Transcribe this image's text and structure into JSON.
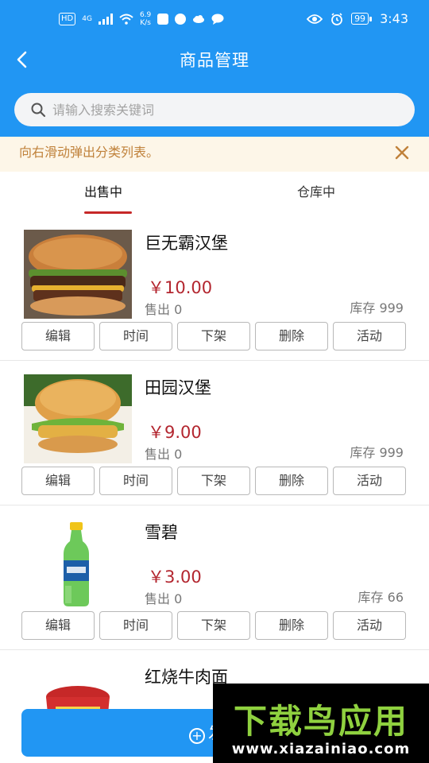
{
  "status_bar": {
    "network": "HD",
    "signal_type": "4G",
    "speed_value": "6.9",
    "speed_unit": "K/s",
    "battery": "99",
    "time": "3:43"
  },
  "header": {
    "title": "商品管理"
  },
  "search": {
    "placeholder": "请输入搜索关键词"
  },
  "notice": {
    "text": "向右滑动弹出分类列表。"
  },
  "tabs": [
    {
      "label": "出售中",
      "active": true
    },
    {
      "label": "仓库中",
      "active": false
    }
  ],
  "products": [
    {
      "name": "巨无霸汉堡",
      "price": "￥10.00",
      "sold": "售出 0",
      "stock": "库存 999",
      "image": "burger-icon"
    },
    {
      "name": "田园汉堡",
      "price": "￥9.00",
      "sold": "售出 0",
      "stock": "库存 999",
      "image": "chicken-burger-icon"
    },
    {
      "name": "雪碧",
      "price": "￥3.00",
      "sold": "售出 0",
      "stock": "库存 66",
      "image": "soda-bottle-icon"
    },
    {
      "name": "红烧牛肉面",
      "price": "",
      "sold": "",
      "stock": "",
      "image": "instant-noodle-icon"
    }
  ],
  "actions": [
    "编辑",
    "时间",
    "下架",
    "删除",
    "活动"
  ],
  "publish_button": {
    "label": "发布"
  },
  "watermark": {
    "title": "下载鸟应用",
    "url": "www.xiazainiao.com"
  },
  "colors": {
    "primary": "#2196f3",
    "price": "#b3262f",
    "notice_bg": "#fdf6e8",
    "notice_text": "#c0813a",
    "tab_underline": "#c62828"
  }
}
